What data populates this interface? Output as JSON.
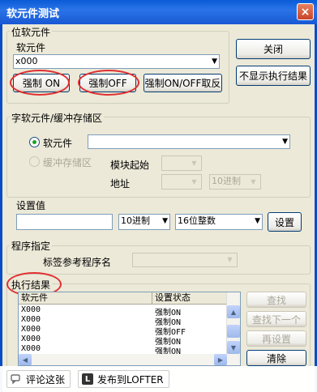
{
  "window": {
    "title": "软元件测试",
    "close_glyph": "×"
  },
  "bit_group": {
    "label": "位软元件",
    "device_label": "软元件",
    "device_value": "x000",
    "force_on": "强制 ON",
    "force_off": "强制OFF",
    "force_invert": "强制ON/OFF取反"
  },
  "right_buttons": {
    "close": "关闭",
    "hide_results": "不显示执行结果"
  },
  "word_group": {
    "label": "字软元件/缓冲存储区",
    "device_radio": "软元件",
    "buffer_radio": "缓冲存储区",
    "module_start_label": "模块起始",
    "address_label": "地址",
    "radix_disabled": "10进制"
  },
  "setting": {
    "label": "设置值",
    "value": "",
    "radix": "10进制",
    "type": "16位整数",
    "set_button": "设置"
  },
  "program": {
    "label": "程序指定",
    "label_ref": "标签参考程序名"
  },
  "results": {
    "label": "执行结果",
    "columns": [
      "软元件",
      "设置状态"
    ],
    "rows": [
      [
        "X000",
        "强制ON"
      ],
      [
        "X000",
        "强制ON"
      ],
      [
        "X000",
        "强制OFF"
      ],
      [
        "X000",
        "强制ON"
      ],
      [
        "X000",
        "强制ON"
      ]
    ],
    "find": "查找",
    "find_next": "查找下一个",
    "reset": "再设置",
    "clear": "清除"
  },
  "bottom": {
    "comment": "评论这张",
    "publish": "发布到LOFTER",
    "publish_icon": "L"
  },
  "colors": {
    "title_bar": "#1958d3",
    "highlight_oval": "#e03030",
    "dialog_bg": "#ece9d8"
  }
}
